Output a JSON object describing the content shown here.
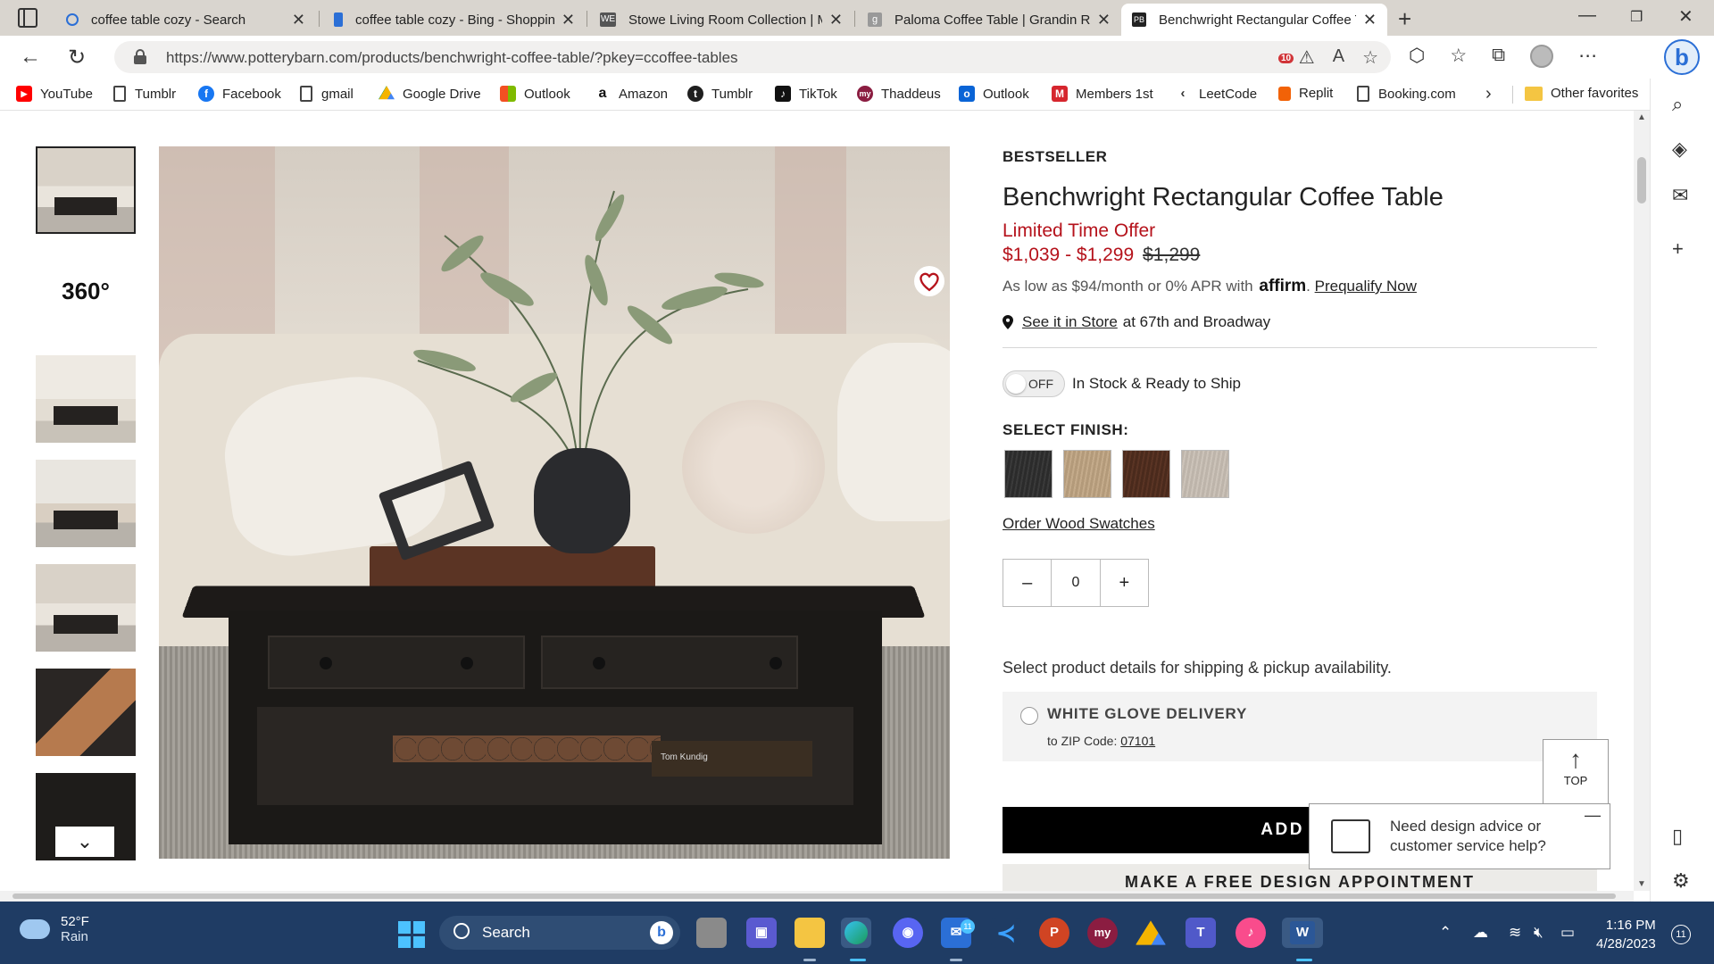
{
  "browser": {
    "tabs": [
      {
        "title": "coffee table cozy - Search",
        "favicon_color": "#2b6fd6"
      },
      {
        "title": "coffee table cozy - Bing - Shopping",
        "favicon_color": "#2b6fd6"
      },
      {
        "title": "Stowe Living Room Collection | Mod",
        "favicon_color": "#555555"
      },
      {
        "title": "Paloma Coffee Table | Grandin Road",
        "favicon_color": "#888888"
      },
      {
        "title": "Benchwright Rectangular Coffee Table",
        "favicon_color": "#222222"
      }
    ],
    "active_tab_index": 4,
    "url": "https://www.potterybarn.com/products/benchwright-coffee-table/?pkey=ccoffee-tables",
    "extension_badge": "10"
  },
  "bookmarks": [
    {
      "label": "YouTube",
      "icon": "youtube-icon",
      "color": "#ff0000"
    },
    {
      "label": "Tumblr",
      "icon": "document-icon",
      "color": ""
    },
    {
      "label": "Facebook",
      "icon": "facebook-icon",
      "color": "#1877f2"
    },
    {
      "label": "gmail",
      "icon": "document-icon",
      "color": ""
    },
    {
      "label": "Google Drive",
      "icon": "google-drive-icon",
      "color": "#0f9d58"
    },
    {
      "label": "Outlook",
      "icon": "microsoft-icon",
      "color": "#f25022"
    },
    {
      "label": "Amazon",
      "icon": "amazon-icon",
      "color": "#111111"
    },
    {
      "label": "Tumblr",
      "icon": "tumblr-icon",
      "color": "#1f1f1f"
    },
    {
      "label": "TikTok",
      "icon": "tiktok-icon",
      "color": "#111111"
    },
    {
      "label": "Thaddeus",
      "icon": "my-icon",
      "color": "#8b1d41"
    },
    {
      "label": "Outlook",
      "icon": "outlook-icon",
      "color": "#0a64d6"
    },
    {
      "label": "Members 1st",
      "icon": "m-icon",
      "color": "#d6262e"
    },
    {
      "label": "LeetCode",
      "icon": "leetcode-icon",
      "color": "#333333"
    },
    {
      "label": "Replit",
      "icon": "replit-icon",
      "color": "#f26207"
    },
    {
      "label": "Booking.com",
      "icon": "document-icon",
      "color": ""
    }
  ],
  "other_favorites": "Other favorites",
  "product": {
    "badge": "BESTSELLER",
    "title": "Benchwright Rectangular Coffee Table",
    "offer": "Limited Time Offer",
    "price_range": "$1,039 - $1,299",
    "original_price": "$1,299",
    "financing_text": "As low as $94/month or 0% APR with",
    "financing_brand": "affirm",
    "prequalify": "Prequalify Now",
    "store_link": "See it in Store",
    "store_location": "at 67th and Broadway",
    "toggle_state": "OFF",
    "stock_label": "In Stock & Ready to Ship",
    "finish_label": "SELECT FINISH:",
    "finishes": [
      "#2b2b2b",
      "#b39a7a",
      "#4a2a1c",
      "#bdb4aa"
    ],
    "order_swatches": "Order Wood Swatches",
    "quantity": "0",
    "qty_minus": "–",
    "qty_plus": "+",
    "shipping_prompt": "Select product details for shipping & pickup availability.",
    "delivery_title": "WHITE GLOVE DELIVERY",
    "zip_prefix": "to ZIP Code:",
    "zip": "07101",
    "add_to_cart": "ADD TO",
    "design_appointment": "MAKE A FREE DESIGN APPOINTMENT",
    "book_label": "Tom Kundig"
  },
  "widgets": {
    "top_label": "TOP",
    "chat_text": "Need design advice or customer service help?"
  },
  "taskbar": {
    "temperature": "52°F",
    "condition": "Rain",
    "search_label": "Search",
    "time": "1:16 PM",
    "date": "4/28/2023",
    "notifications": "11",
    "mail_badge": "11"
  }
}
